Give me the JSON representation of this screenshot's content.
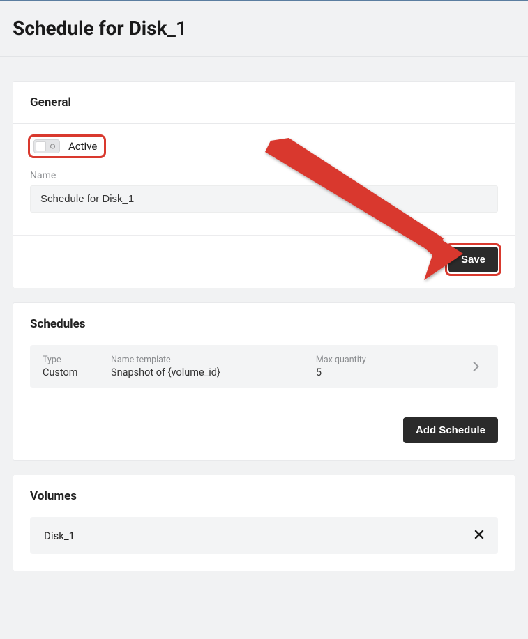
{
  "page_title": "Schedule for Disk_1",
  "general": {
    "section_title": "General",
    "active_label": "Active",
    "name_label": "Name",
    "name_value": "Schedule for Disk_1",
    "save_label": "Save"
  },
  "schedules": {
    "section_title": "Schedules",
    "type_label": "Type",
    "template_label": "Name template",
    "qty_label": "Max quantity",
    "row": {
      "type": "Custom",
      "template": "Snapshot of {volume_id}",
      "qty": "5"
    },
    "add_label": "Add Schedule"
  },
  "volumes": {
    "section_title": "Volumes",
    "items": [
      {
        "name": "Disk_1"
      }
    ]
  },
  "annotation": {
    "arrow_color": "#d9392e",
    "highlight_targets": [
      "active-toggle",
      "save-button"
    ]
  }
}
